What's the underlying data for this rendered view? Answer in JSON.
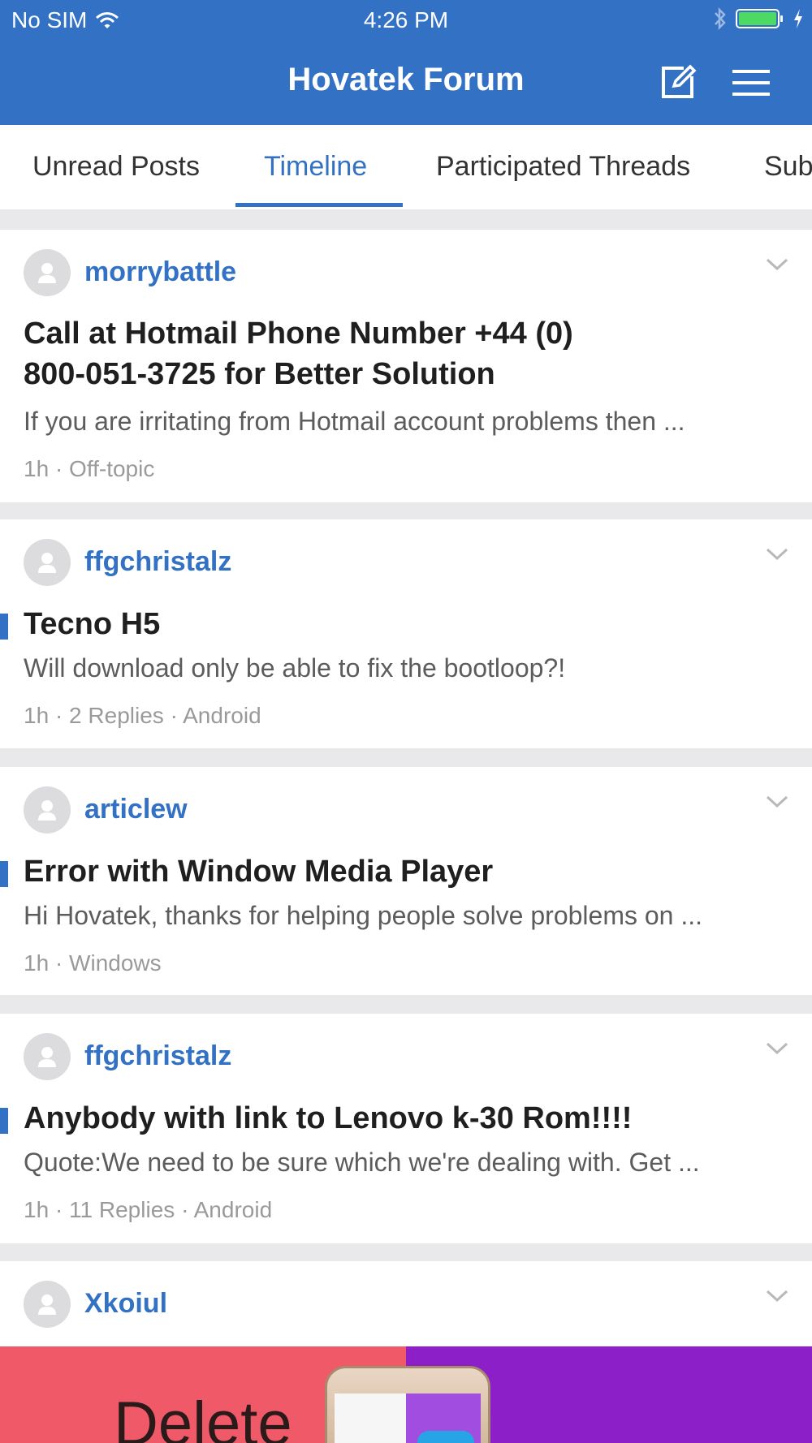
{
  "status_bar": {
    "carrier": "No SIM",
    "time": "4:26 PM",
    "battery_color": "#4cd964"
  },
  "nav": {
    "title": "Hovatek Forum",
    "icons": [
      "compose-icon",
      "hamburger-menu-icon"
    ]
  },
  "tabs": [
    {
      "label": "Unread Posts"
    },
    {
      "label": "Timeline",
      "active": true
    },
    {
      "label": "Participated Threads"
    },
    {
      "label": "Sub"
    }
  ],
  "posts": [
    {
      "author": "morrybattle",
      "title_line1": "Call at Hotmail Phone Number +44 (0)",
      "title_line2": "800-051-3725 for Better Solution",
      "excerpt": "If you are irritating from Hotmail account problems then ...",
      "time": "1h",
      "replies": "",
      "forum": "Off-topic",
      "unread": false
    },
    {
      "author": "ffgchristalz",
      "title_line1": "Tecno H5",
      "title_line2": "",
      "excerpt": "Will download only be able to fix the bootloop?!",
      "time": "1h",
      "replies": "2 Replies",
      "forum": "Android",
      "unread": true
    },
    {
      "author": "articlew",
      "title_line1": "Error with Window Media Player",
      "title_line2": "",
      "excerpt": "Hi Hovatek, thanks for helping people solve problems on ...",
      "time": "1h",
      "replies": "",
      "forum": "Windows",
      "unread": true
    },
    {
      "author": "ffgchristalz",
      "title_line1": "Anybody with link to Lenovo k-30 Rom!!!!",
      "title_line2": "",
      "excerpt": "Quote:We need to be sure which we're dealing with. Get ...",
      "time": "1h",
      "replies": "11 Replies",
      "forum": "Android",
      "unread": true
    },
    {
      "author": "Xkoiul"
    }
  ],
  "ad": {
    "text": "Delete"
  },
  "colors": {
    "brand_blue": "#3271c4",
    "separator": "#e9e9eb"
  }
}
